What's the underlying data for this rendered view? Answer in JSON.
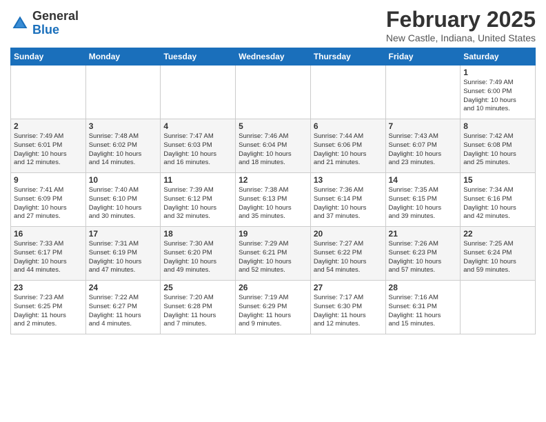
{
  "header": {
    "logo_general": "General",
    "logo_blue": "Blue",
    "month_title": "February 2025",
    "location": "New Castle, Indiana, United States"
  },
  "weekdays": [
    "Sunday",
    "Monday",
    "Tuesday",
    "Wednesday",
    "Thursday",
    "Friday",
    "Saturday"
  ],
  "weeks": [
    [
      {
        "day": "",
        "info": ""
      },
      {
        "day": "",
        "info": ""
      },
      {
        "day": "",
        "info": ""
      },
      {
        "day": "",
        "info": ""
      },
      {
        "day": "",
        "info": ""
      },
      {
        "day": "",
        "info": ""
      },
      {
        "day": "1",
        "info": "Sunrise: 7:49 AM\nSunset: 6:00 PM\nDaylight: 10 hours\nand 10 minutes."
      }
    ],
    [
      {
        "day": "2",
        "info": "Sunrise: 7:49 AM\nSunset: 6:01 PM\nDaylight: 10 hours\nand 12 minutes."
      },
      {
        "day": "3",
        "info": "Sunrise: 7:48 AM\nSunset: 6:02 PM\nDaylight: 10 hours\nand 14 minutes."
      },
      {
        "day": "4",
        "info": "Sunrise: 7:47 AM\nSunset: 6:03 PM\nDaylight: 10 hours\nand 16 minutes."
      },
      {
        "day": "5",
        "info": "Sunrise: 7:46 AM\nSunset: 6:04 PM\nDaylight: 10 hours\nand 18 minutes."
      },
      {
        "day": "6",
        "info": "Sunrise: 7:44 AM\nSunset: 6:06 PM\nDaylight: 10 hours\nand 21 minutes."
      },
      {
        "day": "7",
        "info": "Sunrise: 7:43 AM\nSunset: 6:07 PM\nDaylight: 10 hours\nand 23 minutes."
      },
      {
        "day": "8",
        "info": "Sunrise: 7:42 AM\nSunset: 6:08 PM\nDaylight: 10 hours\nand 25 minutes."
      }
    ],
    [
      {
        "day": "9",
        "info": "Sunrise: 7:41 AM\nSunset: 6:09 PM\nDaylight: 10 hours\nand 27 minutes."
      },
      {
        "day": "10",
        "info": "Sunrise: 7:40 AM\nSunset: 6:10 PM\nDaylight: 10 hours\nand 30 minutes."
      },
      {
        "day": "11",
        "info": "Sunrise: 7:39 AM\nSunset: 6:12 PM\nDaylight: 10 hours\nand 32 minutes."
      },
      {
        "day": "12",
        "info": "Sunrise: 7:38 AM\nSunset: 6:13 PM\nDaylight: 10 hours\nand 35 minutes."
      },
      {
        "day": "13",
        "info": "Sunrise: 7:36 AM\nSunset: 6:14 PM\nDaylight: 10 hours\nand 37 minutes."
      },
      {
        "day": "14",
        "info": "Sunrise: 7:35 AM\nSunset: 6:15 PM\nDaylight: 10 hours\nand 39 minutes."
      },
      {
        "day": "15",
        "info": "Sunrise: 7:34 AM\nSunset: 6:16 PM\nDaylight: 10 hours\nand 42 minutes."
      }
    ],
    [
      {
        "day": "16",
        "info": "Sunrise: 7:33 AM\nSunset: 6:17 PM\nDaylight: 10 hours\nand 44 minutes."
      },
      {
        "day": "17",
        "info": "Sunrise: 7:31 AM\nSunset: 6:19 PM\nDaylight: 10 hours\nand 47 minutes."
      },
      {
        "day": "18",
        "info": "Sunrise: 7:30 AM\nSunset: 6:20 PM\nDaylight: 10 hours\nand 49 minutes."
      },
      {
        "day": "19",
        "info": "Sunrise: 7:29 AM\nSunset: 6:21 PM\nDaylight: 10 hours\nand 52 minutes."
      },
      {
        "day": "20",
        "info": "Sunrise: 7:27 AM\nSunset: 6:22 PM\nDaylight: 10 hours\nand 54 minutes."
      },
      {
        "day": "21",
        "info": "Sunrise: 7:26 AM\nSunset: 6:23 PM\nDaylight: 10 hours\nand 57 minutes."
      },
      {
        "day": "22",
        "info": "Sunrise: 7:25 AM\nSunset: 6:24 PM\nDaylight: 10 hours\nand 59 minutes."
      }
    ],
    [
      {
        "day": "23",
        "info": "Sunrise: 7:23 AM\nSunset: 6:25 PM\nDaylight: 11 hours\nand 2 minutes."
      },
      {
        "day": "24",
        "info": "Sunrise: 7:22 AM\nSunset: 6:27 PM\nDaylight: 11 hours\nand 4 minutes."
      },
      {
        "day": "25",
        "info": "Sunrise: 7:20 AM\nSunset: 6:28 PM\nDaylight: 11 hours\nand 7 minutes."
      },
      {
        "day": "26",
        "info": "Sunrise: 7:19 AM\nSunset: 6:29 PM\nDaylight: 11 hours\nand 9 minutes."
      },
      {
        "day": "27",
        "info": "Sunrise: 7:17 AM\nSunset: 6:30 PM\nDaylight: 11 hours\nand 12 minutes."
      },
      {
        "day": "28",
        "info": "Sunrise: 7:16 AM\nSunset: 6:31 PM\nDaylight: 11 hours\nand 15 minutes."
      },
      {
        "day": "",
        "info": ""
      }
    ]
  ]
}
